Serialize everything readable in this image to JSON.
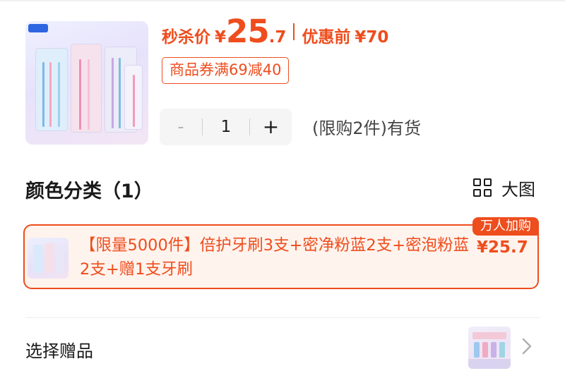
{
  "price": {
    "flash_label": "秒杀价",
    "yen": "¥",
    "integer": "25",
    "decimal": ".7",
    "before_label": "优惠前",
    "before_price": "¥70"
  },
  "coupon": {
    "text": "商品券满69减40"
  },
  "quantity": {
    "minus": "-",
    "value": "1",
    "plus": "+",
    "stock": "(限购2件)有货"
  },
  "color_section": {
    "title": "颜色分类（1）",
    "big_view_label": "大图",
    "options": [
      {
        "name": "【限量5000件】倍护牙刷3支+密净粉蓝2支+密泡粉蓝2支+赠1支牙刷",
        "price": "¥25.7",
        "badge": "万人加购",
        "selected": true
      }
    ]
  },
  "gift": {
    "label": "选择赠品"
  },
  "icons": {
    "grid": "grid-view-icon",
    "chevron": "chevron-right-icon",
    "brand": "brand-logo-icon"
  },
  "colors": {
    "accent": "#ee4d1d",
    "selected_bg": "#fff3ed",
    "stepper_bg": "#f5f5f5"
  }
}
